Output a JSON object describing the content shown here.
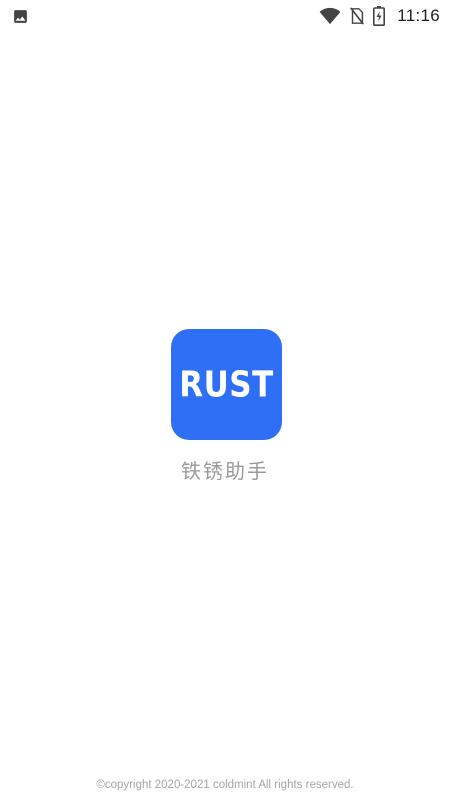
{
  "status_bar": {
    "time": "11:16",
    "icons": {
      "left": "image-icon",
      "wifi": "wifi-icon",
      "sim": "no-sim-icon",
      "battery": "battery-charging-icon"
    }
  },
  "splash": {
    "logo_text": "RUST",
    "app_name": "铁锈助手",
    "copyright": "©copyright 2020-2021 coldmint All rights reserved."
  },
  "colors": {
    "logo_background": "#2f6ff5",
    "app_name_text": "#9a9a9a",
    "copyright_text": "#a6a6a6",
    "background": "#ffffff"
  }
}
